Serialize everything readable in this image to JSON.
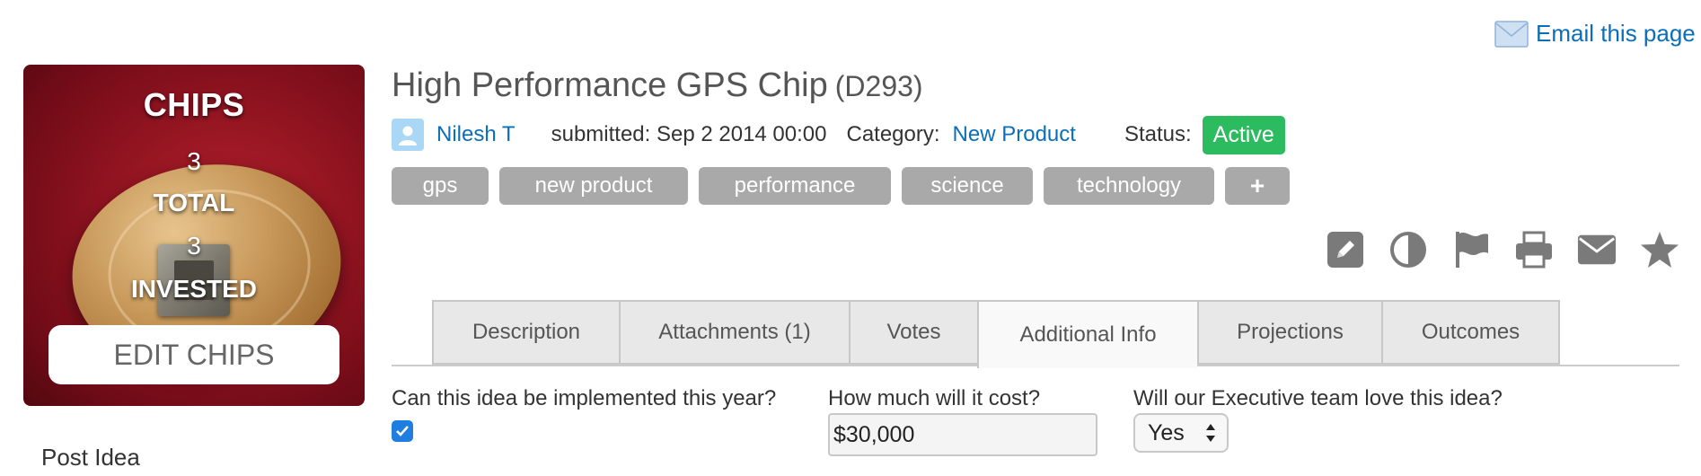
{
  "email_link": {
    "label": "Email this page",
    "icon": "envelope-icon"
  },
  "chips": {
    "title": "CHIPS",
    "total_value": "3",
    "total_label": "TOTAL",
    "invested_value": "3",
    "invested_label": "INVESTED",
    "edit_button": "EDIT CHIPS"
  },
  "sidebar": {
    "post_idea": "Post Idea"
  },
  "idea": {
    "title": "High Performance GPS Chip",
    "code": "(D293)",
    "author": "Nilesh T",
    "submitted": "submitted: Sep 2 2014 00:00",
    "category_label": "Category:",
    "category_value": "New Product",
    "status_label": "Status:",
    "status_value": "Active",
    "status_color": "#2dbb60"
  },
  "tags": [
    "gps",
    "new product",
    "performance",
    "science",
    "technology",
    "+"
  ],
  "actions": [
    "pencil-icon",
    "contrast-icon",
    "flag-icon",
    "print-icon",
    "envelope-icon",
    "star-icon"
  ],
  "tabs": [
    {
      "label": "Description",
      "active": false
    },
    {
      "label": "Attachments (1)",
      "active": false
    },
    {
      "label": "Votes",
      "active": false
    },
    {
      "label": "Additional Info",
      "active": true
    },
    {
      "label": "Projections",
      "active": false
    },
    {
      "label": "Outcomes",
      "active": false
    }
  ],
  "fields": {
    "implement_label": "Can this idea be implemented this year?",
    "implement_checked": true,
    "cost_label": "How much will it cost?",
    "cost_value": "$30,000",
    "exec_label": "Will our Executive team love this idea?",
    "exec_value": "Yes"
  },
  "colors": {
    "link": "#0b6eb8",
    "tag_bg": "#a9a9a9",
    "checkbox": "#1f7fe0"
  }
}
